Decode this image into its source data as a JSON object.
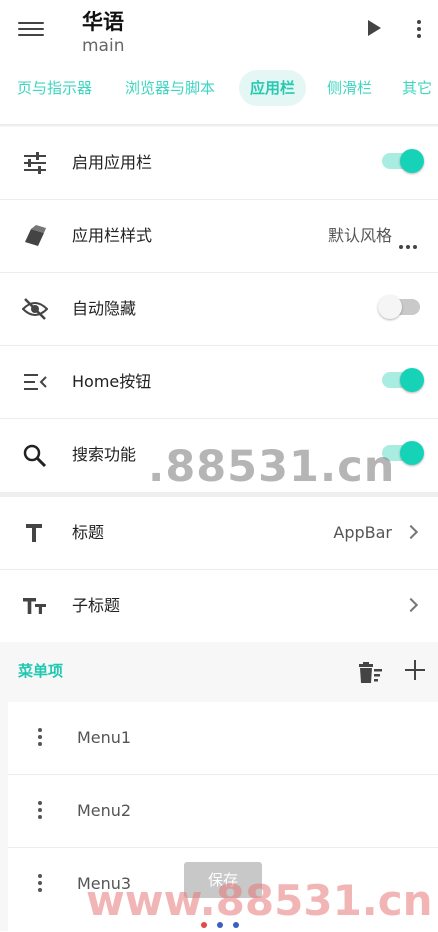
{
  "appbar": {
    "title": "华语",
    "subtitle": "main"
  },
  "tabs": [
    "页与指示器",
    "浏览器与脚本",
    "应用栏",
    "侧滑栏",
    "其它"
  ],
  "active_tab": "应用栏",
  "settings": {
    "enable_appbar": {
      "label": "启用应用栏",
      "on": true
    },
    "appbar_style": {
      "label": "应用栏样式",
      "value": "默认风格"
    },
    "auto_hide": {
      "label": "自动隐藏",
      "on": false
    },
    "home_button": {
      "label": "Home按钮",
      "on": true
    },
    "search": {
      "label": "搜索功能",
      "on": true
    },
    "title": {
      "label": "标题",
      "value": "AppBar"
    },
    "subtitle": {
      "label": "子标题",
      "value": ""
    }
  },
  "menu_section": {
    "title": "菜单项"
  },
  "menu_items": [
    "Menu1",
    "Menu2",
    "Menu3"
  ],
  "save_label": "保存",
  "watermark": "www.88531.cn",
  "watermark_small": ".88531.cn",
  "colors": {
    "accent": "#1fc8b0",
    "switch_on": "#16d3b8",
    "page_dot_red": "#e24a4a",
    "page_dot_blue": "#3b5fc4"
  },
  "icons": [
    "menu-icon",
    "play-icon",
    "more-vert-icon",
    "tune-icon",
    "style-icon",
    "visibility-off-icon",
    "menu-open-icon",
    "search-icon",
    "title-icon",
    "text-fields-icon",
    "delete-sweep-icon",
    "add-icon",
    "drag-handle-icon"
  ]
}
